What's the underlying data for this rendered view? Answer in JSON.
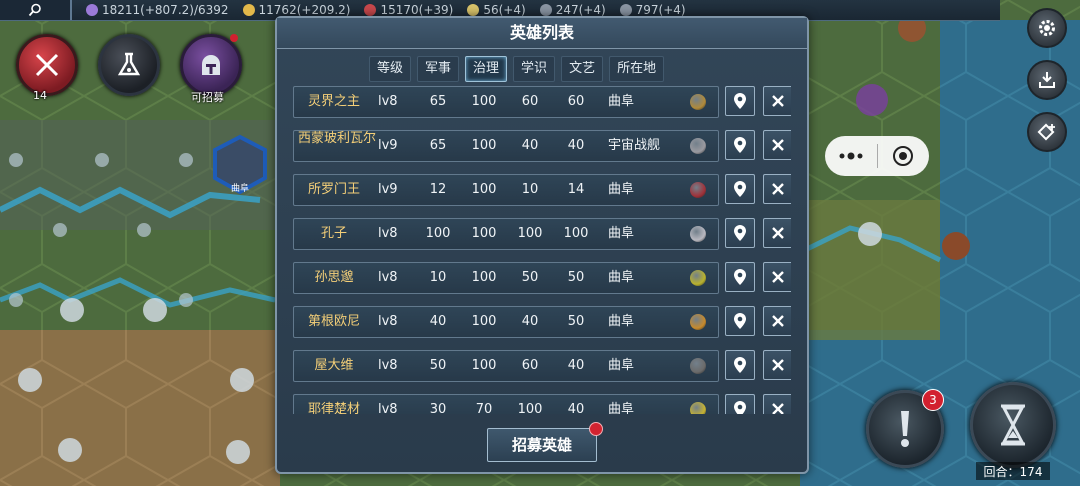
{
  "resources": [
    {
      "icon": "star-icon",
      "color": "#9b7ad8",
      "text": "18211(+807.2)/6392"
    },
    {
      "icon": "coin-icon",
      "color": "#e2b84a",
      "text": "11762(+209.2)"
    },
    {
      "icon": "crossed-swords-icon",
      "color": "#c8484c",
      "text": "15170(+39)"
    },
    {
      "icon": "gear-resource-icon",
      "color": "#d9c36a",
      "text": "56(+4)"
    },
    {
      "icon": "people-icon",
      "color": "#8a95a3",
      "text": "247(+4)"
    },
    {
      "icon": "culture-icon",
      "color": "#8a95a3",
      "text": "797(+4)"
    }
  ],
  "left_buttons": {
    "military_count": "14",
    "recruitable_label": "可招募"
  },
  "map_labels": {
    "city": "曲阜"
  },
  "dialog": {
    "title": "英雄列表",
    "tabs": [
      "等级",
      "军事",
      "治理",
      "学识",
      "文艺",
      "所在地"
    ],
    "active_tab": "治理",
    "recruit_label": "招募英雄",
    "heroes": [
      {
        "name": "灵界之主",
        "level": "lv8",
        "military": "65",
        "governance": "100",
        "knowledge": "60",
        "art": "60",
        "location": "曲阜",
        "item_color": "#b08a3a"
      },
      {
        "name": "西蒙玻利瓦尔",
        "level": "lv9",
        "military": "65",
        "governance": "100",
        "knowledge": "40",
        "art": "40",
        "location": "宇宙战舰",
        "item_color": "#9a9aa0"
      },
      {
        "name": "所罗门王",
        "level": "lv9",
        "military": "12",
        "governance": "100",
        "knowledge": "10",
        "art": "14",
        "location": "曲阜",
        "item_color": "#a0323a"
      },
      {
        "name": "孔子",
        "level": "lv8",
        "military": "100",
        "governance": "100",
        "knowledge": "100",
        "art": "100",
        "location": "曲阜",
        "item_color": "#b8b8c0"
      },
      {
        "name": "孙思邈",
        "level": "lv8",
        "military": "10",
        "governance": "100",
        "knowledge": "50",
        "art": "50",
        "location": "曲阜",
        "item_color": "#b9b22e"
      },
      {
        "name": "第根欧尼",
        "level": "lv8",
        "military": "40",
        "governance": "100",
        "knowledge": "40",
        "art": "50",
        "location": "曲阜",
        "item_color": "#c78a2c"
      },
      {
        "name": "屋大维",
        "level": "lv8",
        "military": "50",
        "governance": "100",
        "knowledge": "60",
        "art": "40",
        "location": "曲阜",
        "item_color": "#6b6b6b"
      },
      {
        "name": "耶律楚材",
        "level": "lv8",
        "military": "30",
        "governance": "70",
        "knowledge": "100",
        "art": "40",
        "location": "曲阜",
        "item_color": "#c5b232"
      }
    ]
  },
  "right_buttons": {
    "alert_badge": "3",
    "turn_label": "回合：174"
  }
}
